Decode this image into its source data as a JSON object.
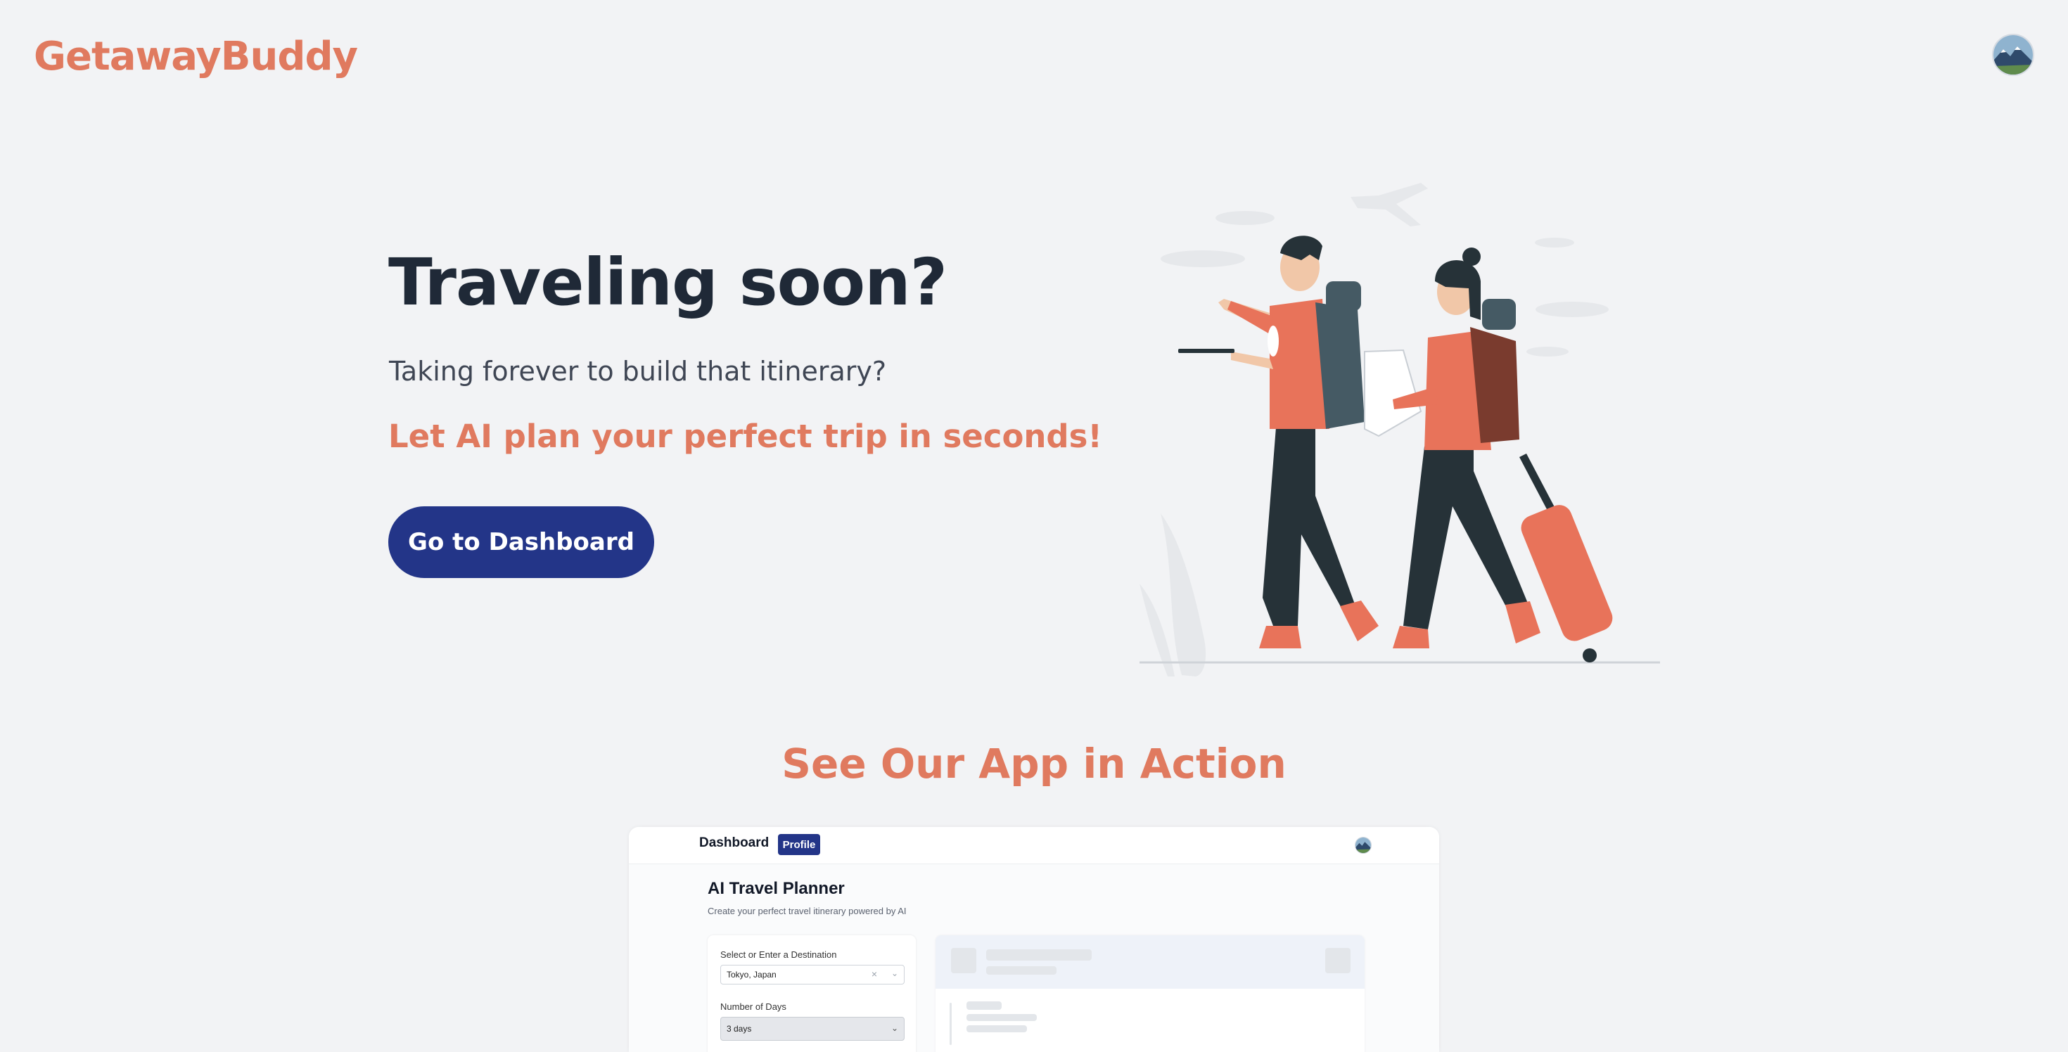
{
  "header": {
    "brand": "GetawayBuddy",
    "avatar_icon": "mountain-landscape-avatar"
  },
  "hero": {
    "title": "Traveling soon?",
    "subtitle": "Taking forever to build that itinerary?",
    "highlight": "Let AI plan your perfect trip in seconds!",
    "cta_label": "Go to Dashboard",
    "illustration": "travelers-with-backpacks-illustration"
  },
  "showcase": {
    "title": "See Our App in Action",
    "preview": {
      "nav_dashboard": "Dashboard",
      "nav_profile": "Profile",
      "title": "AI Travel Planner",
      "subtitle": "Create your perfect travel itinerary powered by AI",
      "destination_label": "Select or Enter a Destination",
      "destination_value": "Tokyo, Japan",
      "days_label": "Number of Days",
      "days_value": "3 days"
    }
  },
  "colors": {
    "background": "#f2f3f5",
    "brand": "#e07a5f",
    "primary_button": "#233588",
    "heading": "#1f2937"
  }
}
